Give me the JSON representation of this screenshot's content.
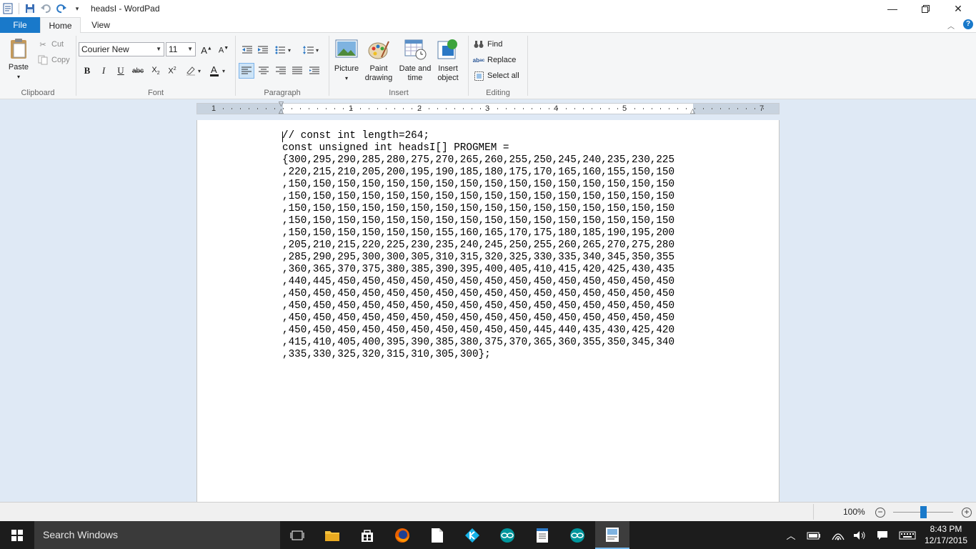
{
  "window": {
    "title": "headsI - WordPad",
    "minimize_icon": "minimize-icon",
    "restore_icon": "restore-icon",
    "close_icon": "close-icon"
  },
  "tabs": {
    "file": "File",
    "home": "Home",
    "view": "View"
  },
  "clipboard": {
    "paste": "Paste",
    "cut": "Cut",
    "copy": "Copy",
    "label": "Clipboard"
  },
  "font": {
    "family": "Courier New",
    "size": "11",
    "label": "Font"
  },
  "paragraph": {
    "label": "Paragraph"
  },
  "insert": {
    "picture": "Picture",
    "paint_line1": "Paint",
    "paint_line2": "drawing",
    "date_line1": "Date and",
    "date_line2": "time",
    "object_line1": "Insert",
    "object_line2": "object",
    "label": "Insert"
  },
  "editing": {
    "find": "Find",
    "replace": "Replace",
    "select_all": "Select all",
    "label": "Editing"
  },
  "ruler": {
    "numbers": [
      "1",
      "1",
      "2",
      "3",
      "4",
      "5",
      "7"
    ]
  },
  "document": {
    "text": "// const int length=264;\nconst unsigned int headsI[] PROGMEM =\n{300,295,290,285,280,275,270,265,260,255,250,245,240,235,230,225\n,220,215,210,205,200,195,190,185,180,175,170,165,160,155,150,150\n,150,150,150,150,150,150,150,150,150,150,150,150,150,150,150,150\n,150,150,150,150,150,150,150,150,150,150,150,150,150,150,150,150\n,150,150,150,150,150,150,150,150,150,150,150,150,150,150,150,150\n,150,150,150,150,150,150,150,150,150,150,150,150,150,150,150,150\n,150,150,150,150,150,150,155,160,165,170,175,180,185,190,195,200\n,205,210,215,220,225,230,235,240,245,250,255,260,265,270,275,280\n,285,290,295,300,300,305,310,315,320,325,330,335,340,345,350,355\n,360,365,370,375,380,385,390,395,400,405,410,415,420,425,430,435\n,440,445,450,450,450,450,450,450,450,450,450,450,450,450,450,450\n,450,450,450,450,450,450,450,450,450,450,450,450,450,450,450,450\n,450,450,450,450,450,450,450,450,450,450,450,450,450,450,450,450\n,450,450,450,450,450,450,450,450,450,450,450,450,450,450,450,450\n,450,450,450,450,450,450,450,450,450,450,445,440,435,430,425,420\n,415,410,405,400,395,390,385,380,375,370,365,360,355,350,345,340\n,335,330,325,320,315,310,305,300};"
  },
  "status": {
    "zoom": "100%",
    "zoom_level_percent": 100
  },
  "taskbar": {
    "search_placeholder": "Search Windows",
    "time": "8:43 PM",
    "date": "12/17/2015"
  },
  "colors": {
    "accent": "#1979ca",
    "ribbon_bg": "#f5f6f7",
    "doc_bg": "#dfe9f5",
    "taskbar_bg": "#1c1c1c"
  }
}
